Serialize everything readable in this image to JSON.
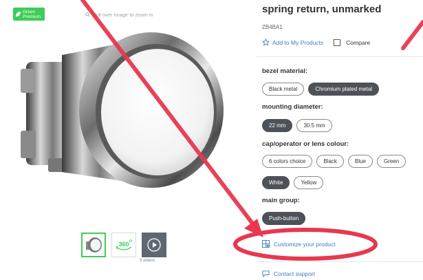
{
  "badge": {
    "line1": "Green",
    "line2": "Premium"
  },
  "zoom_hint": "Roll over image to zoom in",
  "thumbnails": {
    "spin_label": "360",
    "videos_label": "5 videos"
  },
  "product": {
    "title": "spring return, unmarked",
    "sku": "ZB4BA1"
  },
  "actions": {
    "add_label": "Add to My Products",
    "compare_label": "Compare"
  },
  "filters": {
    "bezel": {
      "label": "bezel material:",
      "options": [
        "Black metal",
        "Chromium plated metal"
      ],
      "selected": "Chromium plated metal"
    },
    "mounting": {
      "label": "mounting diameter:",
      "options": [
        "22 mm",
        "30.5 mm"
      ],
      "selected": "22 mm"
    },
    "colour": {
      "label": "cap/operator or lens colour:",
      "options": [
        "6 colors choice",
        "Black",
        "Blue",
        "Green",
        "White",
        "Yellow"
      ],
      "selected": "White"
    },
    "group": {
      "label": "main group:",
      "options": [
        "Push-button"
      ],
      "selected": "Push-button"
    }
  },
  "links": {
    "customize": "Customize your product",
    "contact": "Contact support"
  },
  "colors": {
    "accent_green": "#3dcd58",
    "link_blue": "#3d7bc4",
    "chip_selected": "#4d5258",
    "annotation_red": "#e8384f"
  }
}
